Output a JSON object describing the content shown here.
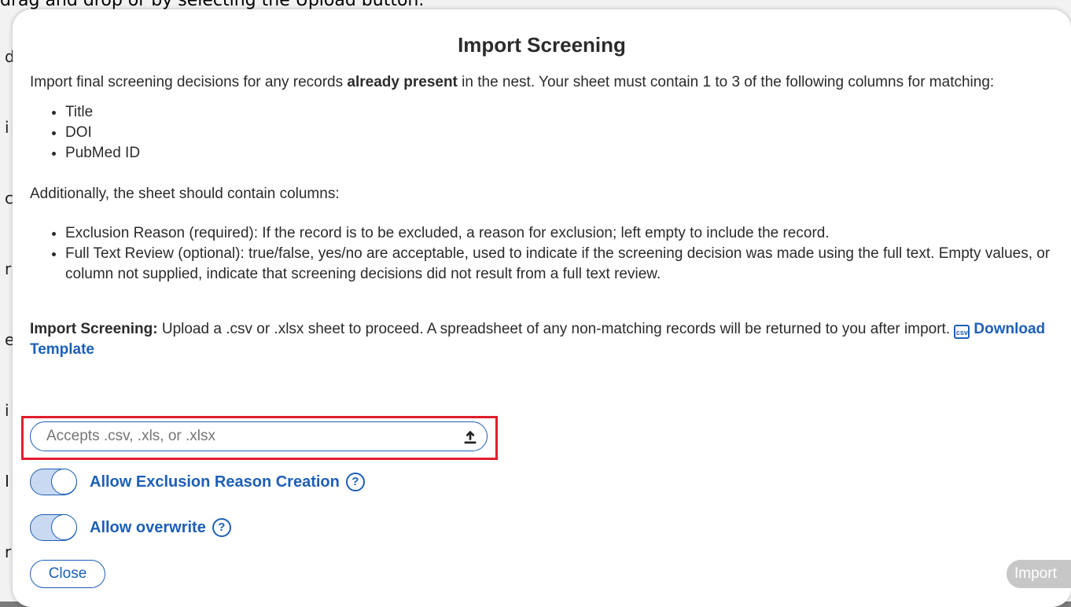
{
  "background": {
    "top_text": "drag and drop or by selecting the Upload button."
  },
  "modal": {
    "title": "Import Screening",
    "intro_prefix": "Import final screening decisions for any records ",
    "intro_bold": "already present",
    "intro_suffix": " in the nest. Your sheet must contain 1 to 3 of the following columns for matching:",
    "match_columns": [
      "Title",
      "DOI",
      "PubMed ID"
    ],
    "additional_text": "Additionally, the sheet should contain columns:",
    "extra_columns": [
      "Exclusion Reason (required): If the record is to be excluded, a reason for exclusion; left empty to include the record.",
      "Full Text Review (optional): true/false, yes/no are acceptable, used to indicate if the screening decision was made using the full text. Empty values, or column not supplied, indicate that screening decisions did not result from a full text review."
    ],
    "import_label": "Import Screening:",
    "import_text": " Upload a .csv or .xlsx sheet to proceed. A spreadsheet of any non-matching records will be returned to you after import. ",
    "csv_icon_text": "csv",
    "download_template": "Download Template",
    "upload_placeholder": "Accepts .csv, .xls, or .xlsx",
    "upload_value": "",
    "toggles": [
      {
        "label": "Allow Exclusion Reason Creation",
        "on": true
      },
      {
        "label": "Allow overwrite",
        "on": true
      }
    ],
    "help_icon_glyph": "?",
    "close_label": "Close",
    "import_button_label": "Import"
  },
  "colors": {
    "accent": "#1d5fb7",
    "highlight": "#e01e2b",
    "disabled": "#c7c7c7"
  }
}
